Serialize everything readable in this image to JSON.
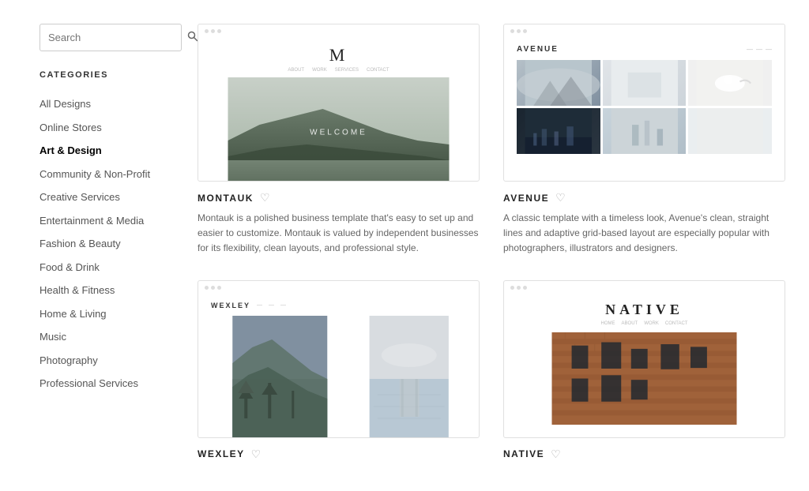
{
  "sidebar": {
    "search": {
      "placeholder": "Search",
      "value": ""
    },
    "categories_label": "CATEGORIES",
    "items": [
      {
        "id": "all-designs",
        "label": "All Designs",
        "active": false
      },
      {
        "id": "online-stores",
        "label": "Online Stores",
        "active": false
      },
      {
        "id": "art-design",
        "label": "Art & Design",
        "active": true
      },
      {
        "id": "community-nonprofit",
        "label": "Community & Non-Profit",
        "active": false
      },
      {
        "id": "creative-services",
        "label": "Creative Services",
        "active": false
      },
      {
        "id": "entertainment-media",
        "label": "Entertainment & Media",
        "active": false
      },
      {
        "id": "fashion-beauty",
        "label": "Fashion & Beauty",
        "active": false
      },
      {
        "id": "food-drink",
        "label": "Food & Drink",
        "active": false
      },
      {
        "id": "health-fitness",
        "label": "Health & Fitness",
        "active": false
      },
      {
        "id": "home-living",
        "label": "Home & Living",
        "active": false
      },
      {
        "id": "music",
        "label": "Music",
        "active": false
      },
      {
        "id": "photography",
        "label": "Photography",
        "active": false
      },
      {
        "id": "professional-services",
        "label": "Professional Services",
        "active": false
      }
    ]
  },
  "templates": [
    {
      "id": "montauk",
      "name": "MONTAUK",
      "description": "Montauk is a polished business template that's easy to set up and easier to customize. Montauk is valued by independent businesses for its flexibility, clean layouts, and professional style."
    },
    {
      "id": "avenue",
      "name": "AVENUE",
      "description": "A classic template with a timeless look, Avenue's clean, straight lines and adaptive grid-based layout are especially popular with photographers, illustrators and designers."
    },
    {
      "id": "wexley",
      "name": "WEXLEY",
      "description": ""
    },
    {
      "id": "native",
      "name": "NATIVE",
      "description": ""
    }
  ],
  "icons": {
    "search": "🔍",
    "heart": "♡",
    "dot": "●"
  }
}
